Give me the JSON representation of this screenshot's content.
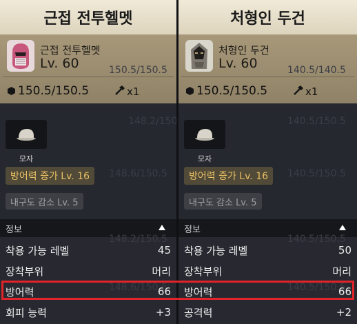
{
  "left": {
    "title": "근접 전투헬멧",
    "name": "근접 전투헬멧",
    "level": "Lv. 60",
    "weight": "150.5/150.5",
    "count": "x1",
    "type_label": "모자",
    "enchant": "방어력 증가 Lv. 16",
    "debuff": "내구도 감소 Lv. 5",
    "ghost_a": "150.5/150.5",
    "ghost_b": "148.2/150.5",
    "ghost_c": "148.6/150.5",
    "ghost_d": "148.2/150.5",
    "ghost_e": "148.6/150.5",
    "info_title": "정보",
    "rows": [
      {
        "label": "착용 가능 레벨",
        "value": "45"
      },
      {
        "label": "장착부위",
        "value": "머리"
      },
      {
        "label": "방어력",
        "value": "66"
      },
      {
        "label": "회피 능력",
        "value": "+3"
      }
    ]
  },
  "right": {
    "title": "처형인 두건",
    "name": "처형인 두건",
    "level": "Lv. 60",
    "weight": "150.5/150.5",
    "count": "x1",
    "type_label": "모자",
    "enchant": "방어력 증가 Lv. 16",
    "debuff": "내구도 감소 Lv. 5",
    "ghost_a": "140.5/140.5",
    "ghost_b": "140.5/150.5",
    "ghost_c": "140.5/150.5",
    "ghost_d": "140.5/150.5",
    "ghost_e": "140.5/150.5",
    "info_title": "정보",
    "rows": [
      {
        "label": "착용 가능 레벨",
        "value": "50"
      },
      {
        "label": "장착부위",
        "value": "머리"
      },
      {
        "label": "방어력",
        "value": "66"
      },
      {
        "label": "공격력",
        "value": "+2"
      }
    ]
  },
  "icons": {
    "left_item": "helmet-icon",
    "right_item": "hood-icon",
    "weight": "weight-icon",
    "hammer": "hammer-icon",
    "type": "cap-icon",
    "collapse": "triangle-up-icon"
  },
  "colors": {
    "title_bg": "#ece5d2",
    "card_bg": "#a0916f",
    "enchant_text": "#e9c063",
    "highlight": "#e0242a"
  }
}
